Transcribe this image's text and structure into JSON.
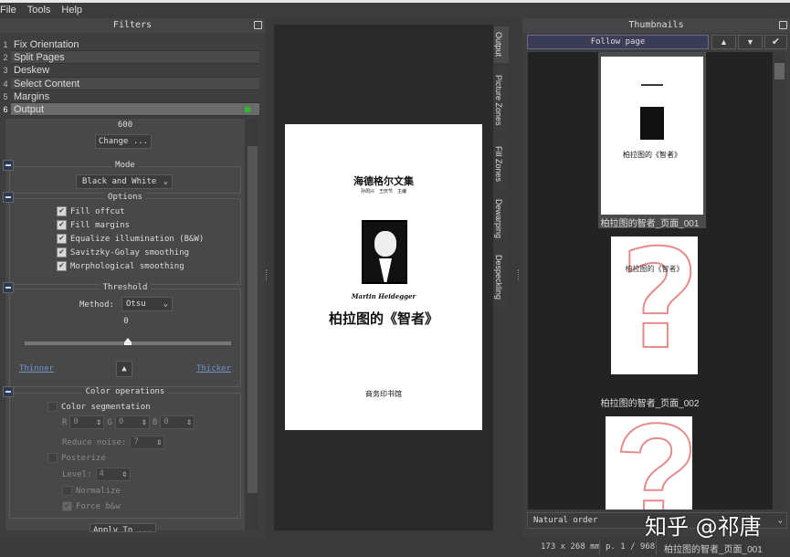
{
  "menu": [
    "File",
    "Tools",
    "Help"
  ],
  "filters": {
    "title": "Filters",
    "items": [
      {
        "n": "1",
        "label": "Fix Orientation"
      },
      {
        "n": "2",
        "label": "Split Pages"
      },
      {
        "n": "3",
        "label": "Deskew"
      },
      {
        "n": "4",
        "label": "Select Content"
      },
      {
        "n": "5",
        "label": "Margins"
      },
      {
        "n": "6",
        "label": "Output"
      }
    ]
  },
  "output": {
    "dpi": "600",
    "change_label": "Change ...",
    "mode_title": "Mode",
    "mode_value": "Black and White",
    "options_title": "Options",
    "options": [
      {
        "label": "Fill offcut",
        "checked": true
      },
      {
        "label": "Fill margins",
        "checked": true
      },
      {
        "label": "Equalize illumination (B&W)",
        "checked": true
      },
      {
        "label": "Savitzky-Golay smoothing",
        "checked": true
      },
      {
        "label": "Morphological smoothing",
        "checked": true
      }
    ],
    "threshold_title": "Threshold",
    "method_label": "Method:",
    "method_value": "Otsu",
    "threshold_value": "0",
    "threshold_slider": 0.5,
    "thinner": "Thinner",
    "thicker": "Thicker",
    "color_ops_title": "Color operations",
    "color_seg": "Color segmentation",
    "r_label": "R",
    "r": "0",
    "g_label": "G",
    "g": "0",
    "b_label": "B",
    "b": "0",
    "reduce_noise_label": "Reduce noise:",
    "reduce_noise": "7",
    "posterize": "Posterize",
    "level_label": "Level:",
    "level": "4",
    "normalize": "Normalize",
    "force_bw": "Force b&w",
    "apply_to": "Apply To ..."
  },
  "view_tabs": [
    "Output",
    "Picture Zones",
    "Fill Zones",
    "Dewarping",
    "Despeckling"
  ],
  "page": {
    "series": "海德格尔文集",
    "editors": "孙周兴　王庆节　主编",
    "author": "Martin Heidegger",
    "title": "柏拉图的《智者》",
    "publisher": "商务印书馆"
  },
  "thumbnails": {
    "title": "Thumbnails",
    "follow_page": "Follow page",
    "up": "▲",
    "down": "▼",
    "check": "✔",
    "items": [
      {
        "caption": "柏拉图的智者_页面_001"
      },
      {
        "caption": "柏拉图的智者_页面_002"
      }
    ],
    "sort": "Natural order"
  },
  "status": {
    "size": "173 x 268 mm",
    "page": "p. 1 / 968",
    "filename": "柏拉图的智者_页面_001"
  },
  "watermark": "知乎 @祁唐"
}
